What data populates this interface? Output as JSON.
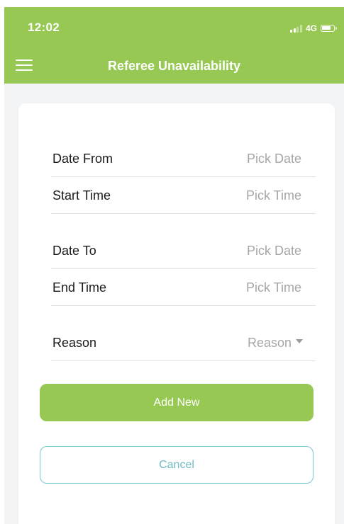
{
  "status_bar": {
    "time": "12:02",
    "network": "4G",
    "signal_icon": "cellular-signal-icon",
    "battery_icon": "battery-icon"
  },
  "nav": {
    "title": "Referee Unavailability",
    "menu_icon": "hamburger-menu-icon"
  },
  "form": {
    "date_from": {
      "label": "Date From",
      "placeholder": "Pick Date"
    },
    "start_time": {
      "label": "Start Time",
      "placeholder": "Pick Time"
    },
    "date_to": {
      "label": "Date To",
      "placeholder": "Pick Date"
    },
    "end_time": {
      "label": "End Time",
      "placeholder": "Pick Time"
    },
    "reason": {
      "label": "Reason",
      "placeholder": "Reason",
      "icon": "caret-down-icon"
    }
  },
  "actions": {
    "add_label": "Add New",
    "cancel_label": "Cancel"
  },
  "colors": {
    "brand_green": "#96c853",
    "cancel_border": "#7bc7cf",
    "background": "#f3f4f6",
    "placeholder_text": "#a6a6a6"
  }
}
